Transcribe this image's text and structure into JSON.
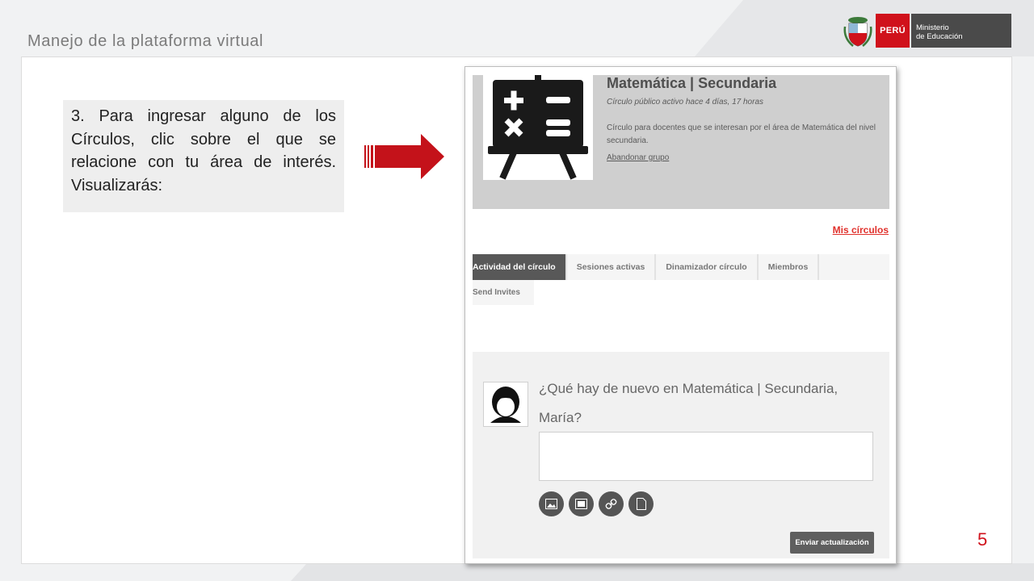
{
  "header": {
    "deck_title": "Manejo de la plataforma virtual",
    "logo": {
      "country": "PERÚ",
      "ministry_line1": "Ministerio",
      "ministry_line2": "de Educación"
    }
  },
  "instruction": {
    "text": "3. Para ingresar alguno de los Círculos, clic sobre el que se relacione con tu área de interés. Visualizarás:"
  },
  "page_number": "5",
  "colors": {
    "brand_red": "#d0111b",
    "arrow_red": "#c4121a",
    "ministry_gray": "#4a4a4a"
  },
  "screenshot": {
    "circle": {
      "name": "Matemática | Secundaria",
      "status": "Círculo público activo hace 4 días, 17 horas",
      "description": "Círculo para docentes que se interesan por el  área de Matemática del nivel secundaria.",
      "leave_link": "Abandonar grupo",
      "image_icon": "math-board-icon"
    },
    "my_circles_link": "Mis círculos",
    "tabs": [
      {
        "label": "Actividad del círculo",
        "active": true
      },
      {
        "label": "Sesiones activas",
        "active": false
      },
      {
        "label": "Dinamizador círculo",
        "active": false
      },
      {
        "label": "Miembros",
        "active": false
      }
    ],
    "send_invites": "Send Invites",
    "post": {
      "prompt": "¿Qué hay de nuevo en Matemática | Secundaria, María?",
      "tools": [
        "image-icon",
        "video-icon",
        "link-icon",
        "file-icon"
      ],
      "submit_label": "Enviar actualización"
    }
  }
}
